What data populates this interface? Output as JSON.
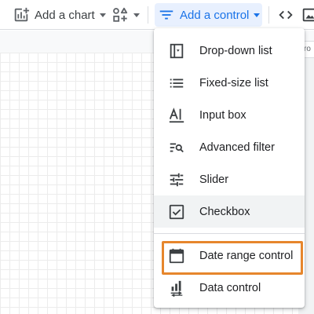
{
  "toolbar": {
    "add_chart_label": "Add a chart",
    "add_control_label": "Add a control",
    "add_chart_icon": "add-chart-icon",
    "community_icon": "community-visualization-icon",
    "control_icon": "filter-lines-icon",
    "embed_icon": "code-embed-icon",
    "image_icon": "image-icon",
    "accent_color": "#1a73e8",
    "active_bg": "#e8f0fe"
  },
  "side_tab": {
    "text": "ro"
  },
  "menu": {
    "items": [
      {
        "label": "Drop-down list",
        "icon": "dropdown-list-icon"
      },
      {
        "label": "Fixed-size list",
        "icon": "list-icon"
      },
      {
        "label": "Input box",
        "icon": "input-box-icon"
      },
      {
        "label": "Advanced filter",
        "icon": "advanced-filter-icon"
      },
      {
        "label": "Slider",
        "icon": "slider-icon"
      },
      {
        "label": "Checkbox",
        "icon": "checkbox-icon"
      },
      {
        "label": "Date range control",
        "icon": "calendar-icon"
      },
      {
        "label": "Data control",
        "icon": "data-control-icon"
      }
    ],
    "highlight_color": "#e6862c"
  }
}
